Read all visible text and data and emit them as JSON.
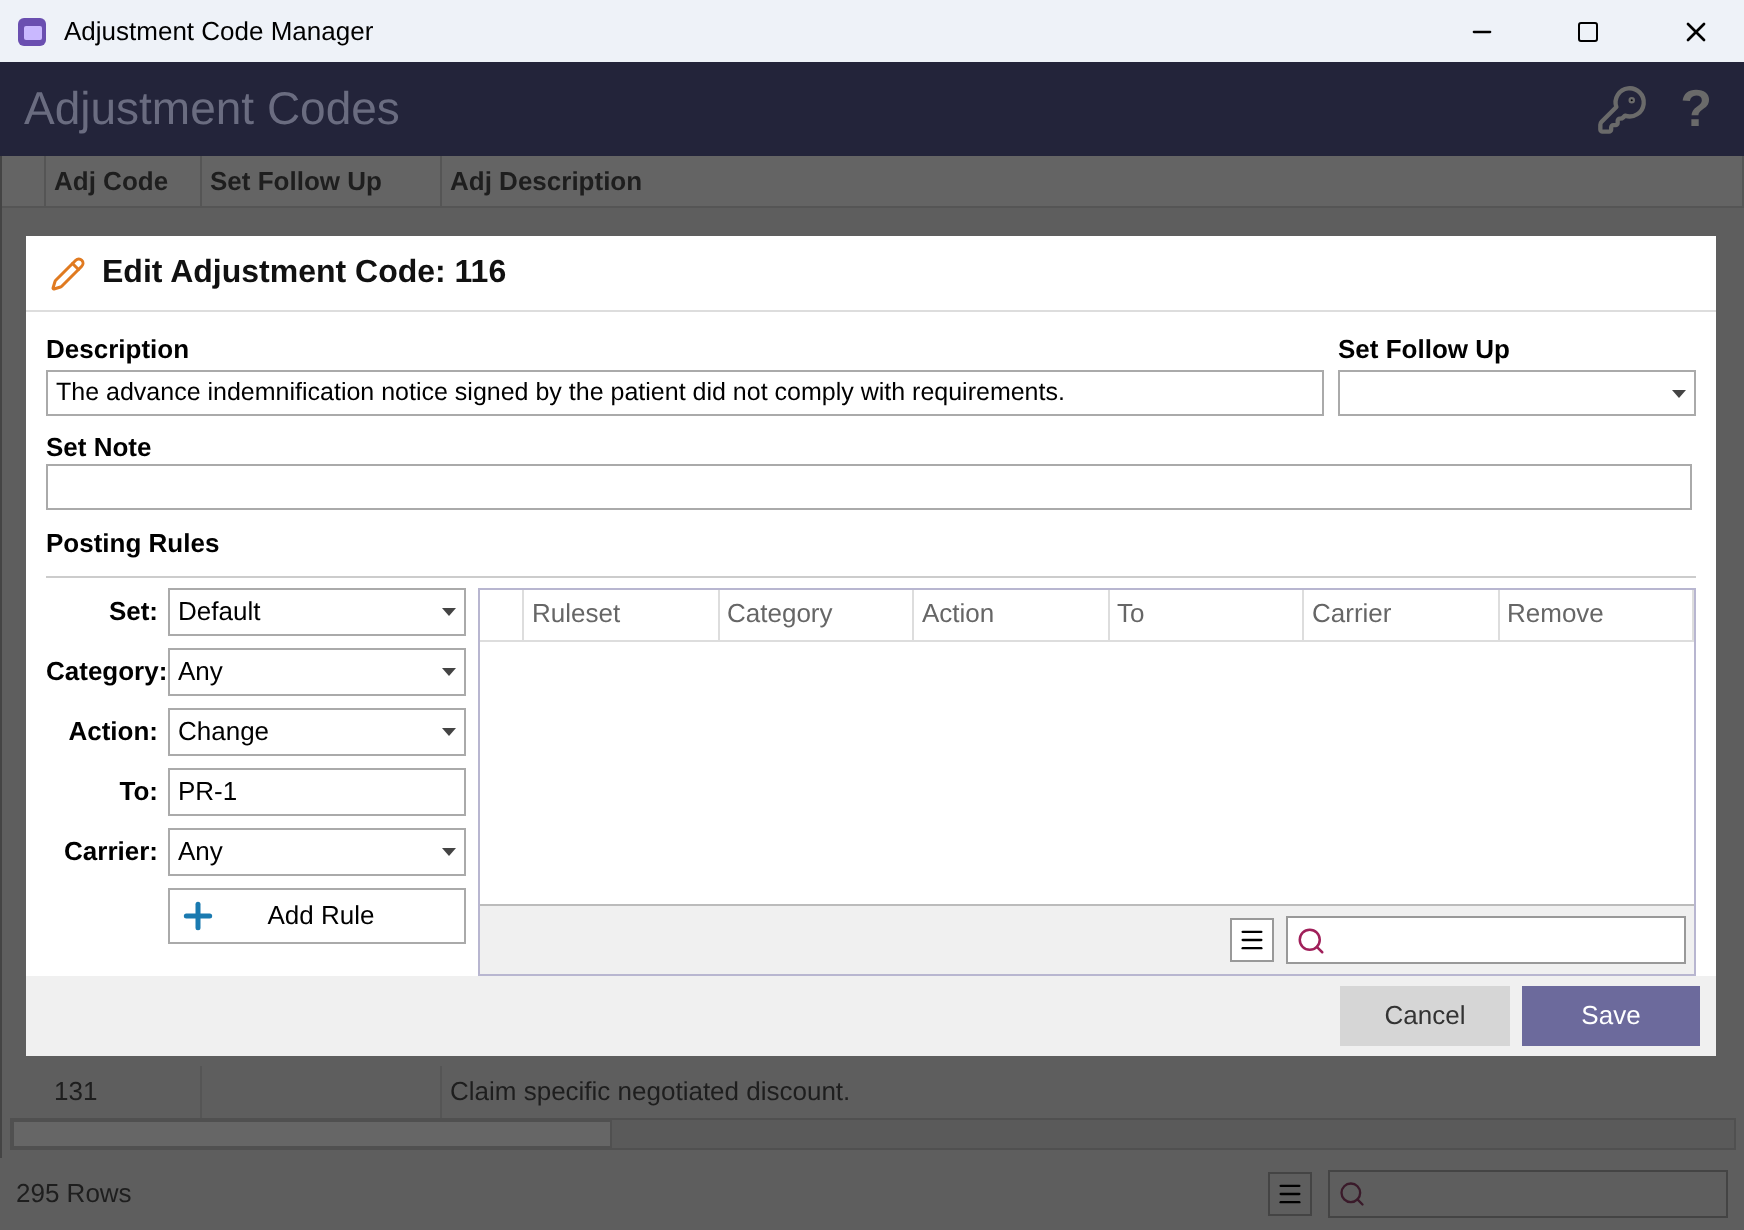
{
  "window": {
    "title": "Adjustment Code Manager"
  },
  "header": {
    "title": "Adjustment Codes",
    "help": "?"
  },
  "table": {
    "columns": [
      "Adj Code",
      "Set Follow Up",
      "Adj Description"
    ],
    "rows": [
      {
        "adj_code": "131",
        "adj_description": "Claim specific negotiated discount."
      }
    ]
  },
  "status_bar": {
    "row_count": "295 Rows"
  },
  "dialog": {
    "title": "Edit Adjustment Code: 116",
    "description": {
      "label": "Description",
      "value": "The advance indemnification notice signed by the patient did not comply with requirements."
    },
    "follow_up": {
      "label": "Set Follow Up"
    },
    "note": {
      "label": "Set Note"
    },
    "posting_rules": {
      "title": "Posting Rules",
      "fields": [
        {
          "label": "Set:",
          "value": "Default",
          "kind": "dropdown"
        },
        {
          "label": "Category:",
          "value": "Any",
          "kind": "dropdown"
        },
        {
          "label": "Action:",
          "value": "Change",
          "kind": "dropdown"
        },
        {
          "label": "To:",
          "value": "PR-1",
          "kind": "text"
        },
        {
          "label": "Carrier:",
          "value": "Any",
          "kind": "dropdown"
        }
      ],
      "add_button": "Add Rule",
      "columns": [
        "Ruleset",
        "Category",
        "Action",
        "To",
        "Carrier",
        "Remove"
      ]
    },
    "buttons": [
      {
        "label": "Cancel",
        "kind": "secondary"
      },
      {
        "label": "Save",
        "kind": "primary"
      }
    ]
  }
}
